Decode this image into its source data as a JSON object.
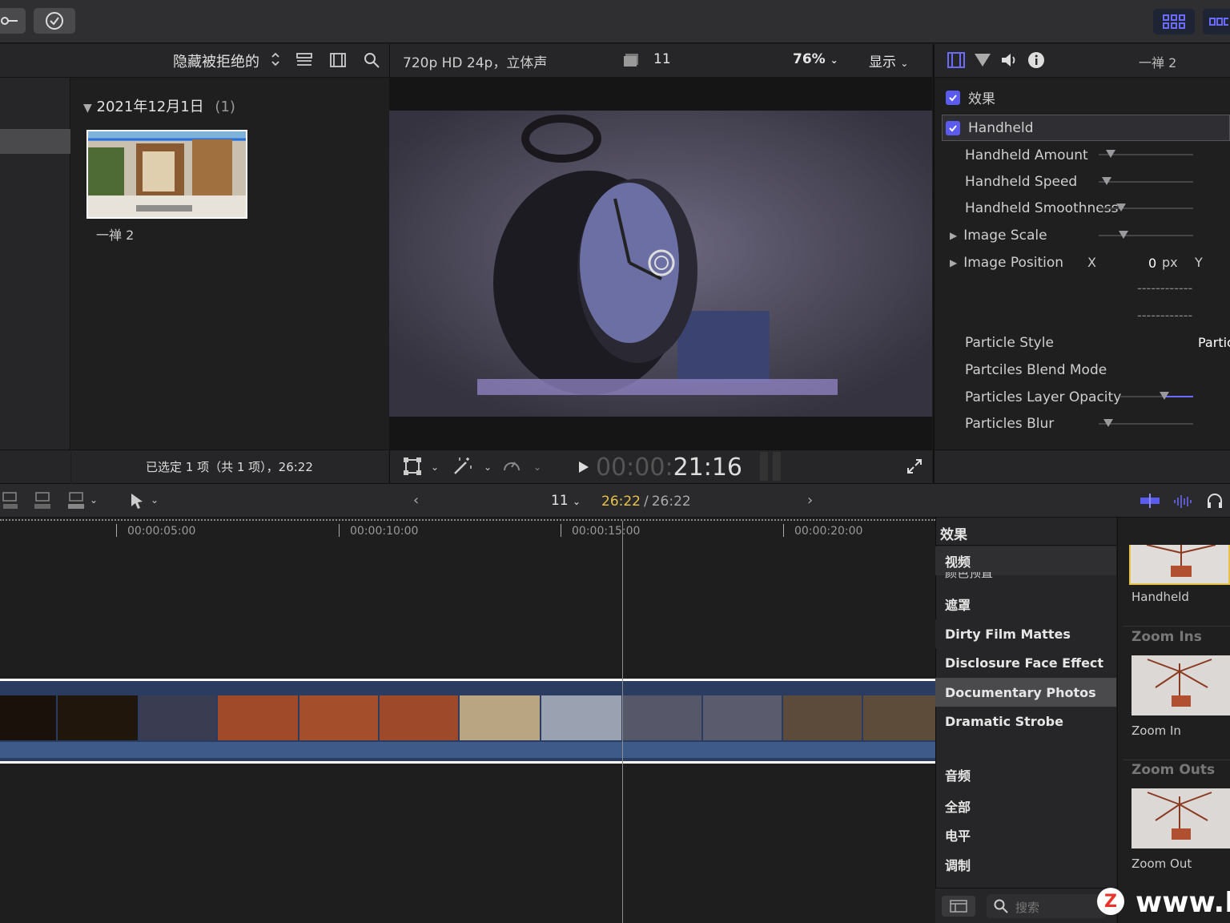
{
  "browser": {
    "filter_label": "隐藏被拒绝的",
    "date_header": "2021年12月1日",
    "date_count": "(1)",
    "clip_name": "一禅 2",
    "selection_status": "已选定 1 项（共 1 项），26:22"
  },
  "viewer": {
    "format": "720p HD 24p，立体声",
    "clip_index": "11",
    "zoom": "76%",
    "display_label": "显示",
    "timecode_dim": "00:00:",
    "timecode_bright": "21:16"
  },
  "inspector": {
    "clip_title": "一禅 2",
    "effects_label": "效果",
    "effect_name": "Handheld",
    "params": [
      {
        "label": "Handheld Amount",
        "value": 0.1
      },
      {
        "label": "Handheld Speed",
        "value": 0.05
      },
      {
        "label": "Handheld Smoothness",
        "value": 0.2
      },
      {
        "label": "Image Scale",
        "value": 0.3
      },
      {
        "label": "Image Position"
      },
      {
        "label": "Particle Style"
      },
      {
        "label": "Partciles Blend Mode"
      },
      {
        "label": "Particles Layer Opacity",
        "value": 0.6
      },
      {
        "label": "Particles Blur",
        "value": 0.1
      }
    ],
    "pos_x_label": "X",
    "pos_x_value": "0",
    "pos_unit": "px",
    "pos_y_label": "Y",
    "dashes": "------------",
    "particle_style_value": "Partic"
  },
  "timeline": {
    "clip_index": "11",
    "playhead_time": "26:22",
    "separator": "/",
    "duration": "26:22",
    "ruler": [
      "00:00:05:00",
      "00:00:10:00",
      "00:00:15:00",
      "00:00:20:00"
    ]
  },
  "effects_browser": {
    "header": "效果",
    "categories": [
      "视频",
      "颜色预置",
      "遮罩",
      "Dirty Film Mattes",
      "Disclosure Face Effect",
      "Documentary Photos",
      "Dramatic Strobe",
      "音频",
      "全部",
      "电平",
      "调制"
    ],
    "selected": "Documentary Photos",
    "tiles": [
      {
        "group": "",
        "label": "Handheld"
      },
      {
        "group": "Zoom Ins",
        "label": "Zoom In"
      },
      {
        "group": "Zoom Outs",
        "label": "Zoom Out"
      }
    ],
    "search_placeholder": "搜索",
    "watermark": "www.M"
  },
  "colors": {
    "accent": "#5b5bf0",
    "playhead_time": "#e8c24a",
    "selection": "#4a4a4d"
  }
}
